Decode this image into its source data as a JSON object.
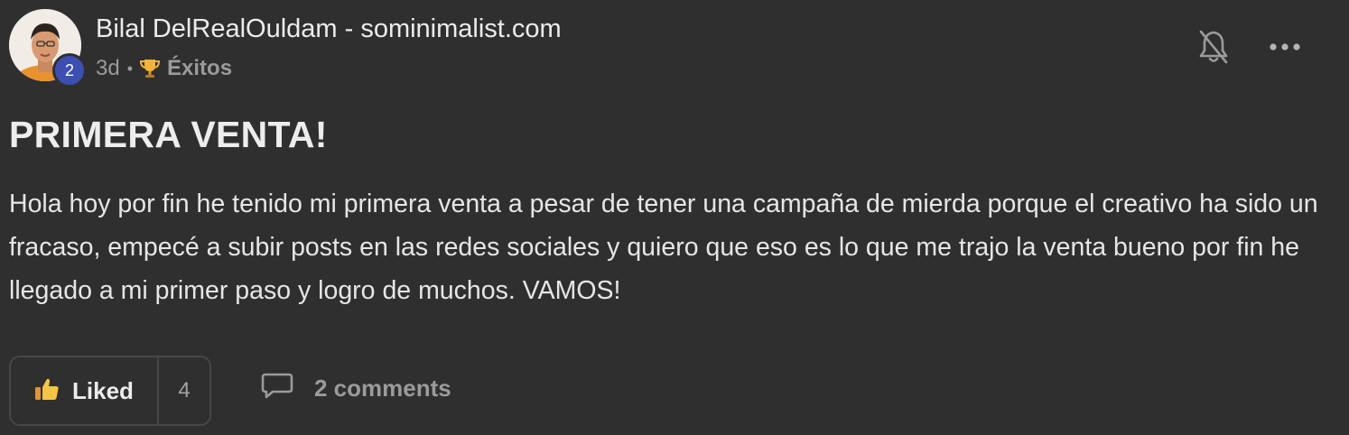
{
  "post": {
    "author": "Bilal DelRealOuldam - sominimalist.com",
    "level": "2",
    "time": "3d",
    "separator": "•",
    "category": "Éxitos",
    "title": "PRIMERA VENTA!",
    "body": "Hola hoy por fin he tenido mi primera venta a pesar de tener una campaña de mierda porque el creativo ha sido un fracaso, empecé a subir posts en las redes sociales y quiero que eso es lo que me trajo la venta bueno por fin he llegado a mi primer paso y logro de muchos. VAMOS!",
    "like_label": "Liked",
    "like_count": "4",
    "comments_label": "2 comments"
  },
  "icons": {
    "avatar": "user-photo",
    "trophy": "trophy-icon",
    "bell": "bell-off-icon",
    "more": "more-horizontal-icon",
    "like": "thumbs-up-icon",
    "comment": "comment-icon"
  },
  "colors": {
    "background": "#2f2f2f",
    "level_badge": "#3d4fb3",
    "muted_text": "#9b9b9b",
    "trophy": "#f2b53a"
  }
}
